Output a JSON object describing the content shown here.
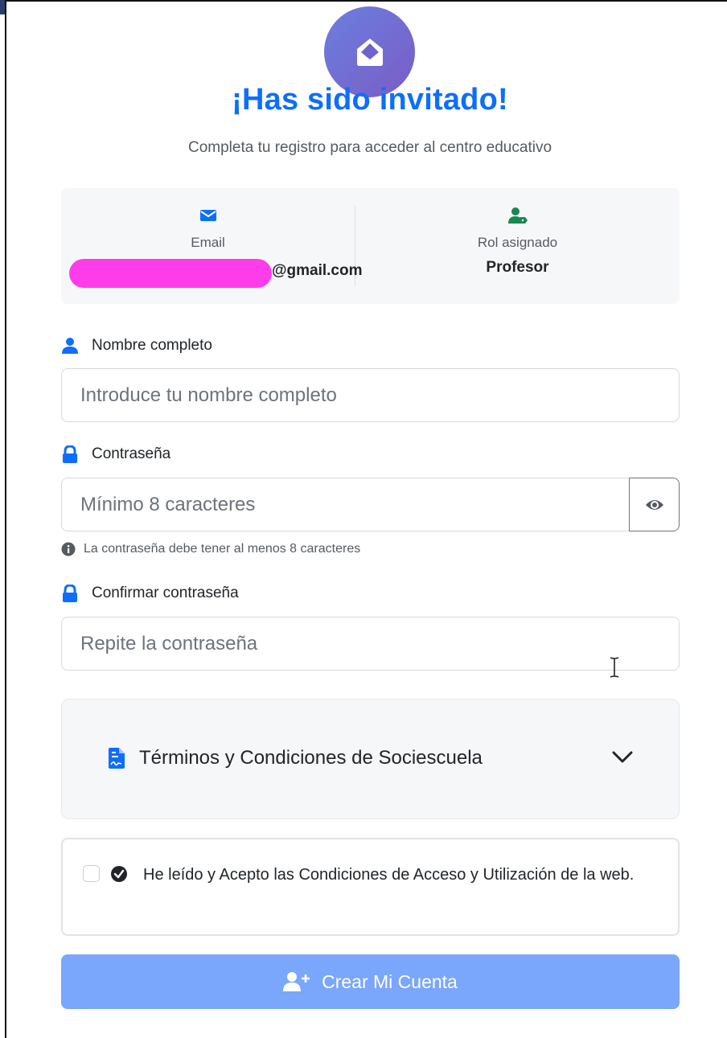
{
  "header": {
    "title": "¡Has sido invitado!",
    "subtitle": "Completa tu registro para acceder al centro educativo",
    "logo_icon": "envelope-open-icon"
  },
  "invitation": {
    "email_label": "Email",
    "email_value": "@gmail.com",
    "role_label": "Rol asignado",
    "role_value": "Profesor"
  },
  "form": {
    "name_label": "Nombre completo",
    "name_placeholder": "Introduce tu nombre completo",
    "password_label": "Contraseña",
    "password_placeholder": "Mínimo 8 caracteres",
    "password_hint": "La contraseña debe tener al menos 8 caracteres",
    "confirm_label": "Confirmar contraseña",
    "confirm_placeholder": "Repite la contraseña"
  },
  "terms": {
    "title": "Términos y Condiciones de Sociescuela"
  },
  "accept": {
    "text": "He leído y Acepto las Condiciones de Acceso y Utilización de la web.",
    "checked": false
  },
  "submit": {
    "label": "Crear Mi Cuenta"
  },
  "colors": {
    "primary": "#0d6efd",
    "role_icon": "#198754",
    "submit_disabled": "#7aa6fc",
    "logo_gradient_start": "#6a7fe0",
    "logo_gradient_end": "#7b5cc4"
  }
}
